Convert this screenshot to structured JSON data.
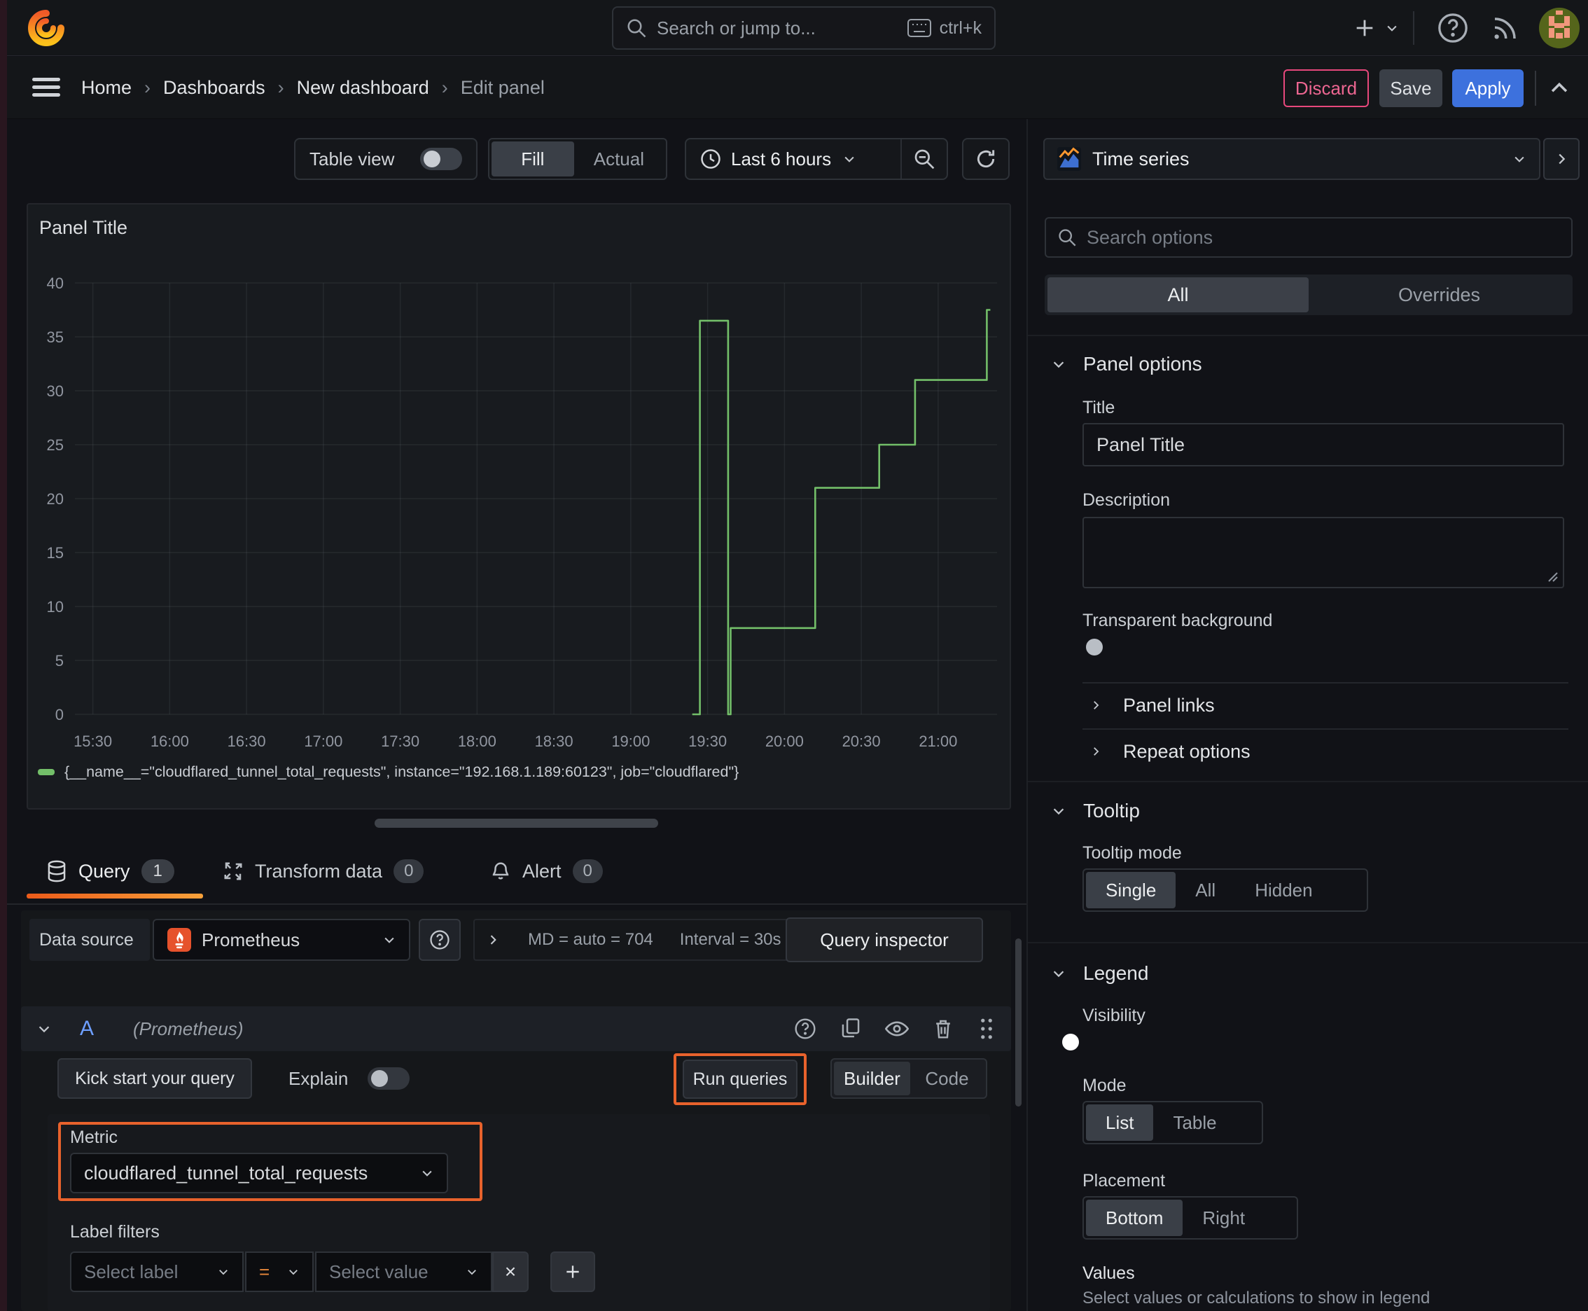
{
  "topbar": {
    "search_placeholder": "Search or jump to...",
    "shortcut": "ctrl+k"
  },
  "breadcrumb": {
    "items": [
      "Home",
      "Dashboards",
      "New dashboard",
      "Edit panel"
    ]
  },
  "header_actions": {
    "discard": "Discard",
    "save": "Save",
    "apply": "Apply"
  },
  "panel_toolbar": {
    "table_view": "Table view",
    "fill": "Fill",
    "actual": "Actual",
    "time_range": "Last 6 hours"
  },
  "panel": {
    "title": "Panel Title",
    "legend_label": "{__name__=\"cloudflared_tunnel_total_requests\", instance=\"192.168.1.189:60123\", job=\"cloudflared\"}"
  },
  "chart_data": {
    "type": "line",
    "title": "Panel Title",
    "x_range": [
      "15:23",
      "21:23"
    ],
    "x_ticks": [
      "15:30",
      "16:00",
      "16:30",
      "17:00",
      "17:30",
      "18:00",
      "18:30",
      "19:00",
      "19:30",
      "20:00",
      "20:30",
      "21:00"
    ],
    "ylim": [
      0,
      40
    ],
    "y_ticks": [
      0,
      5,
      10,
      15,
      20,
      25,
      30,
      35,
      40
    ],
    "grid": true,
    "legend_position": "bottom",
    "series": [
      {
        "name": "{__name__=\"cloudflared_tunnel_total_requests\", instance=\"192.168.1.189:60123\", job=\"cloudflared\"}",
        "color": "#73bf69",
        "line_style": "step-after",
        "points": [
          [
            "19:24",
            0
          ],
          [
            "19:27",
            36.5
          ],
          [
            "19:38",
            0
          ],
          [
            "19:39",
            8
          ],
          [
            "20:12",
            21
          ],
          [
            "20:37",
            25
          ],
          [
            "20:51",
            31
          ],
          [
            "21:19",
            37.5
          ]
        ]
      }
    ]
  },
  "tabs": {
    "query": {
      "label": "Query",
      "count": "1"
    },
    "transform": {
      "label": "Transform data",
      "count": "0"
    },
    "alert": {
      "label": "Alert",
      "count": "0"
    }
  },
  "datasource": {
    "label": "Data source",
    "name": "Prometheus",
    "stat_md": "MD = auto = 704",
    "stat_interval": "Interval = 30s",
    "inspector": "Query inspector"
  },
  "query": {
    "ref_id": "A",
    "ds_hint": "(Prometheus)",
    "kick_start": "Kick start your query",
    "explain": "Explain",
    "run_queries": "Run queries",
    "builder": "Builder",
    "code": "Code",
    "metric_label": "Metric",
    "metric_value": "cloudflared_tunnel_total_requests",
    "label_filters": "Label filters",
    "select_label": "Select label",
    "operator": "=",
    "select_value": "Select value"
  },
  "sidebar": {
    "visualization": "Time series",
    "search_placeholder": "Search options",
    "filter_tabs": {
      "all": "All",
      "overrides": "Overrides"
    },
    "panel_options": {
      "header": "Panel options",
      "title_label": "Title",
      "title_value": "Panel Title",
      "description_label": "Description",
      "transparent_label": "Transparent background",
      "panel_links": "Panel links",
      "repeat_options": "Repeat options"
    },
    "tooltip": {
      "header": "Tooltip",
      "mode_label": "Tooltip mode",
      "options": [
        "Single",
        "All",
        "Hidden"
      ],
      "selected": "Single"
    },
    "legend": {
      "header": "Legend",
      "visibility_label": "Visibility",
      "mode_label": "Mode",
      "mode_options": [
        "List",
        "Table"
      ],
      "placement_label": "Placement",
      "placement_options": [
        "Bottom",
        "Right"
      ],
      "values_label": "Values",
      "values_hint": "Select values or calculations to show in legend"
    }
  },
  "colors": {
    "accent_orange": "#ff780a",
    "annotation_orange": "#e8622c",
    "apply_blue": "#3d71dd",
    "discard_pink": "#e7487c",
    "series_green": "#73bf69",
    "toggle_blue": "#3d71d9"
  }
}
